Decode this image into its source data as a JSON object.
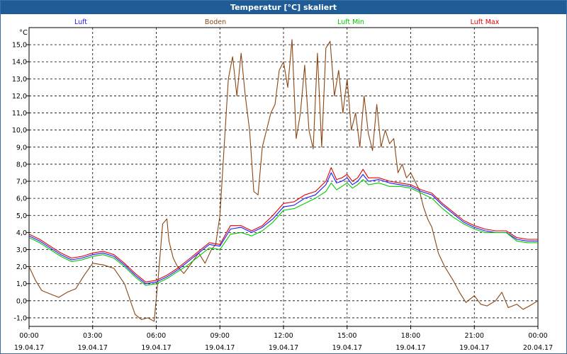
{
  "window": {
    "title": "Temperatur [°C] skaliert"
  },
  "chart_data": {
    "type": "line",
    "title": "Temperatur [°C] skaliert",
    "ylabel": "°C",
    "xlabel": "",
    "ylim": [
      -1.5,
      16.0
    ],
    "xlim": [
      0,
      24
    ],
    "yticks": [
      -1.0,
      0.0,
      1.0,
      2.0,
      3.0,
      4.0,
      5.0,
      6.0,
      7.0,
      8.0,
      9.0,
      10.0,
      11.0,
      12.0,
      13.0,
      14.0,
      15.0
    ],
    "ytick_labels": [
      "-1,0",
      "0,0",
      "1,0",
      "2,0",
      "3,0",
      "4,0",
      "5,0",
      "6,0",
      "7,0",
      "8,0",
      "9,0",
      "10,0",
      "11,0",
      "12,0",
      "13,0",
      "14,0",
      "15,0"
    ],
    "xticks": [
      0,
      3,
      6,
      9,
      12,
      15,
      18,
      21,
      24
    ],
    "xtick_times": [
      "00:00",
      "03:00",
      "06:00",
      "09:00",
      "12:00",
      "15:00",
      "18:00",
      "21:00",
      "00:00"
    ],
    "xtick_dates": [
      "19.04.17",
      "19.04.17",
      "19.04.17",
      "19.04.17",
      "19.04.17",
      "19.04.17",
      "19.04.17",
      "19.04.17",
      "20.04.17"
    ],
    "grid": true,
    "legend_position": "top",
    "x_unit": "hours since 19.04.17 00:00",
    "series": [
      {
        "name": "Luft",
        "color": "#1a1aff",
        "x": [
          0,
          0.5,
          1,
          1.5,
          2,
          2.5,
          3,
          3.5,
          4,
          4.5,
          5,
          5.5,
          6,
          6.5,
          7,
          7.5,
          8,
          8.5,
          9,
          9.5,
          10,
          10.5,
          11,
          11.5,
          12,
          12.5,
          13,
          13.5,
          14,
          14.25,
          14.5,
          14.75,
          15,
          15.25,
          15.5,
          15.75,
          16,
          16.5,
          17,
          17.5,
          18,
          18.5,
          19,
          19.5,
          20,
          20.5,
          21,
          21.5,
          22,
          22.5,
          23,
          23.5,
          24
        ],
        "y": [
          3.8,
          3.5,
          3.1,
          2.7,
          2.4,
          2.5,
          2.7,
          2.8,
          2.6,
          2.1,
          1.5,
          1.0,
          1.1,
          1.4,
          1.8,
          2.3,
          2.8,
          3.3,
          3.2,
          4.2,
          4.3,
          4.0,
          4.3,
          4.8,
          5.5,
          5.6,
          6.0,
          6.2,
          6.8,
          7.5,
          6.9,
          7.0,
          7.2,
          6.8,
          7.0,
          7.4,
          7.0,
          7.1,
          6.9,
          6.8,
          6.7,
          6.4,
          6.2,
          5.6,
          5.1,
          4.6,
          4.3,
          4.1,
          4.0,
          4.0,
          3.6,
          3.5,
          3.5
        ]
      },
      {
        "name": "Boden",
        "color": "#8b4513",
        "x": [
          0,
          0.3,
          0.6,
          1,
          1.4,
          1.8,
          2.2,
          2.6,
          3,
          3.5,
          4,
          4.5,
          5,
          5.3,
          5.6,
          5.9,
          6.1,
          6.3,
          6.5,
          6.6,
          6.8,
          7,
          7.3,
          7.6,
          8,
          8.3,
          8.6,
          8.8,
          9,
          9.2,
          9.4,
          9.6,
          9.8,
          10,
          10.2,
          10.4,
          10.6,
          10.8,
          11,
          11.2,
          11.4,
          11.6,
          11.8,
          12,
          12.2,
          12.4,
          12.6,
          12.8,
          13,
          13.2,
          13.4,
          13.6,
          13.8,
          14,
          14.2,
          14.4,
          14.6,
          14.8,
          15,
          15.2,
          15.4,
          15.6,
          15.8,
          16,
          16.2,
          16.4,
          16.6,
          16.8,
          17,
          17.2,
          17.4,
          17.6,
          17.8,
          18,
          18.2,
          18.4,
          18.6,
          18.8,
          19,
          19.3,
          19.6,
          20,
          20.3,
          20.6,
          21,
          21.3,
          21.6,
          22,
          22.3,
          22.6,
          23,
          23.3,
          23.6,
          24
        ],
        "y": [
          2.0,
          1.2,
          0.6,
          0.4,
          0.2,
          0.5,
          0.7,
          1.5,
          2.2,
          2.1,
          1.9,
          1.0,
          -0.8,
          -1.1,
          -1.0,
          -1.2,
          1.5,
          4.5,
          4.8,
          3.5,
          2.5,
          2.0,
          1.6,
          2.1,
          2.8,
          2.2,
          3.0,
          3.3,
          5.0,
          9.0,
          13.0,
          14.3,
          12.0,
          14.5,
          12.0,
          10.0,
          6.4,
          6.2,
          9.0,
          10.0,
          11.0,
          11.5,
          13.5,
          14.0,
          12.5,
          15.3,
          9.5,
          11.0,
          13.8,
          10.0,
          8.9,
          14.5,
          9.0,
          14.8,
          15.2,
          12.0,
          13.5,
          11.0,
          13.0,
          10.0,
          11.0,
          9.0,
          12.0,
          9.8,
          8.8,
          11.5,
          9.0,
          10.0,
          9.2,
          9.5,
          7.5,
          8.0,
          7.2,
          7.5,
          7.0,
          6.5,
          5.5,
          4.8,
          4.3,
          2.8,
          2.0,
          1.2,
          0.5,
          -0.1,
          0.3,
          -0.2,
          -0.3,
          0.0,
          0.5,
          -0.4,
          -0.2,
          -0.5,
          -0.3,
          0.0
        ]
      },
      {
        "name": "Luft Min",
        "color": "#00c800",
        "x": [
          0,
          0.5,
          1,
          1.5,
          2,
          2.5,
          3,
          3.5,
          4,
          4.5,
          5,
          5.5,
          6,
          6.5,
          7,
          7.5,
          8,
          8.5,
          9,
          9.5,
          10,
          10.5,
          11,
          11.5,
          12,
          12.5,
          13,
          13.5,
          14,
          14.25,
          14.5,
          14.75,
          15,
          15.25,
          15.5,
          15.75,
          16,
          16.5,
          17,
          17.5,
          18,
          18.5,
          19,
          19.5,
          20,
          20.5,
          21,
          21.5,
          22,
          22.5,
          23,
          23.5,
          24
        ],
        "y": [
          3.7,
          3.4,
          3.0,
          2.6,
          2.3,
          2.4,
          2.6,
          2.7,
          2.5,
          2.0,
          1.4,
          0.9,
          1.0,
          1.3,
          1.7,
          2.1,
          2.6,
          3.1,
          3.0,
          3.9,
          4.0,
          3.8,
          4.1,
          4.6,
          5.3,
          5.4,
          5.7,
          6.0,
          6.4,
          6.9,
          6.5,
          6.7,
          6.9,
          6.6,
          6.8,
          7.1,
          6.8,
          6.9,
          6.7,
          6.7,
          6.6,
          6.3,
          6.0,
          5.4,
          4.9,
          4.5,
          4.2,
          4.0,
          4.0,
          4.0,
          3.5,
          3.4,
          3.4
        ]
      },
      {
        "name": "Luft Max",
        "color": "#e00000",
        "x": [
          0,
          0.5,
          1,
          1.5,
          2,
          2.5,
          3,
          3.5,
          4,
          4.5,
          5,
          5.5,
          6,
          6.5,
          7,
          7.5,
          8,
          8.5,
          9,
          9.5,
          10,
          10.5,
          11,
          11.5,
          12,
          12.5,
          13,
          13.5,
          14,
          14.25,
          14.5,
          14.75,
          15,
          15.25,
          15.5,
          15.75,
          16,
          16.5,
          17,
          17.5,
          18,
          18.5,
          19,
          19.5,
          20,
          20.5,
          21,
          21.5,
          22,
          22.5,
          23,
          23.5,
          24
        ],
        "y": [
          3.9,
          3.6,
          3.2,
          2.8,
          2.5,
          2.6,
          2.8,
          2.9,
          2.7,
          2.2,
          1.6,
          1.1,
          1.2,
          1.5,
          1.9,
          2.4,
          2.9,
          3.4,
          3.3,
          4.4,
          4.4,
          4.1,
          4.4,
          5.0,
          5.7,
          5.8,
          6.2,
          6.4,
          7.0,
          7.8,
          7.1,
          7.2,
          7.4,
          7.0,
          7.2,
          7.7,
          7.2,
          7.2,
          7.0,
          6.9,
          6.8,
          6.5,
          6.3,
          5.7,
          5.2,
          4.7,
          4.4,
          4.2,
          4.1,
          4.1,
          3.7,
          3.6,
          3.6
        ]
      }
    ]
  }
}
